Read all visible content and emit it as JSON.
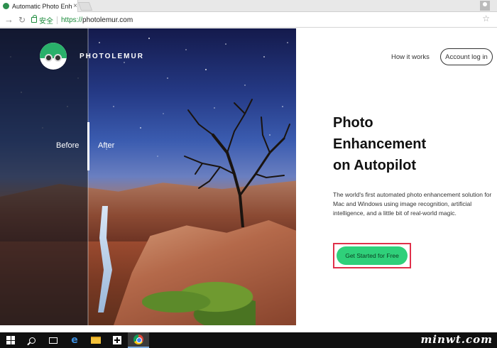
{
  "browser": {
    "tab_title": "Automatic Photo Enhan",
    "tab_close": "×",
    "secure_label": "安全",
    "url_scheme": "https://",
    "url_host": "photolemur.com"
  },
  "site": {
    "brand": "PHOTOLEMUR",
    "nav": {
      "how_it_works": "How it works",
      "account_login": "Account log in"
    },
    "hero": {
      "before_label": "Before",
      "after_label": "After"
    },
    "headline": [
      "Photo",
      "Enhancement",
      "on Autopilot"
    ],
    "description": "The world's first automated photo enhancement solution for Mac and Windows using image recognition, artificial intelligence, and a little bit of real-world magic.",
    "cta_label": "Get Started for Free"
  },
  "taskbar": {
    "items": [
      "windows-start",
      "search",
      "task-view",
      "edge",
      "file-explorer",
      "store",
      "chrome"
    ],
    "watermark": "minwt.com"
  },
  "colors": {
    "accent_green": "#2fd07a",
    "highlight_red": "#e0304a",
    "secure_green": "#1a8a3a"
  }
}
